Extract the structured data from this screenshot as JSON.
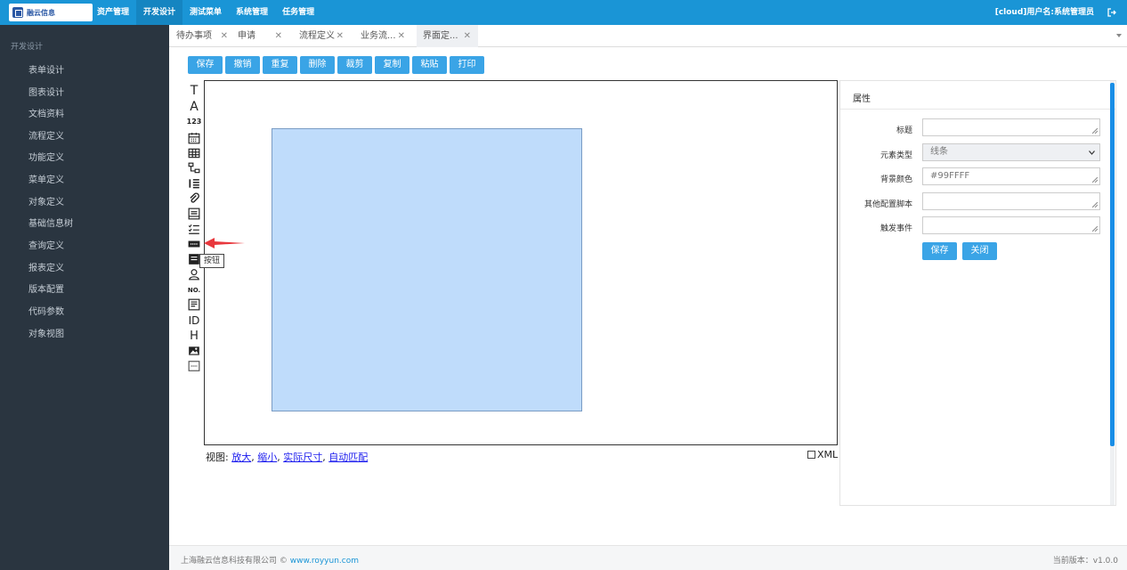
{
  "logo": {
    "text": "融云信息"
  },
  "topnav": {
    "items": [
      "资产管理",
      "开发设计",
      "测试菜单",
      "系统管理",
      "任务管理"
    ],
    "active_index": 1
  },
  "user": {
    "label": "[cloud]用户名:系统管理员"
  },
  "sidebar": {
    "section_title": "开发设计",
    "items": [
      "表单设计",
      "图表设计",
      "文档资料",
      "流程定义",
      "功能定义",
      "菜单定义",
      "对象定义",
      "基础信息树",
      "查询定义",
      "报表定义",
      "版本配置",
      "代码参数",
      "对象视图"
    ]
  },
  "tabs": [
    {
      "label": "待办事项"
    },
    {
      "label": "申请"
    },
    {
      "label": "流程定义"
    },
    {
      "label": "业务流..."
    },
    {
      "label": "界面定..."
    }
  ],
  "tab_close": "✕",
  "toolbar": {
    "buttons": [
      "保存",
      "撤销",
      "重复",
      "删除",
      "裁剪",
      "复制",
      "粘贴",
      "打印"
    ]
  },
  "palette": {
    "tooltip": "按钮",
    "glyphs": {
      "text": "T",
      "label": "A",
      "number": "123",
      "no": "NO.",
      "id": "ID",
      "heading": "H"
    },
    "icons": [
      "text-tool-icon",
      "label-tool-icon",
      "number-tool-icon",
      "date-tool-icon",
      "table-tool-icon",
      "tree-tool-icon",
      "list-tool-icon",
      "attachment-tool-icon",
      "form-tool-icon",
      "checklist-tool-icon",
      "button-tool-icon",
      "panel-tool-icon",
      "user-tool-icon",
      "serial-no-tool-icon",
      "textarea-tool-icon",
      "id-tool-icon",
      "heading-tool-icon",
      "image-tool-icon",
      "custom-tool-icon"
    ]
  },
  "viewbar": {
    "label": "视图:",
    "links": [
      "放大",
      "缩小",
      "实际尺寸",
      "自动匹配"
    ],
    "sep": ", "
  },
  "xml_toggle": {
    "label": "XML",
    "checked": false
  },
  "properties": {
    "title": "属性",
    "fields": [
      {
        "label": "标题",
        "value": "",
        "placeholder": ""
      },
      {
        "label": "元素类型",
        "value": "线条"
      },
      {
        "label": "背景颜色",
        "value": "",
        "placeholder": "#99FFFF"
      },
      {
        "label": "其他配置脚本",
        "value": ""
      },
      {
        "label": "触发事件",
        "value": ""
      }
    ],
    "save_label": "保存",
    "close_label": "关闭"
  },
  "footer": {
    "company": "上海融云信息科技有限公司 © ",
    "website": "www.royyun.com",
    "version": "当前版本：v1.0.0"
  },
  "colors": {
    "topbar": "#1a95d6",
    "sidebar": "#2a3540",
    "button": "#3aa4e6",
    "shape_fill": "#bfdcfb",
    "arrow": "#e8383d"
  }
}
